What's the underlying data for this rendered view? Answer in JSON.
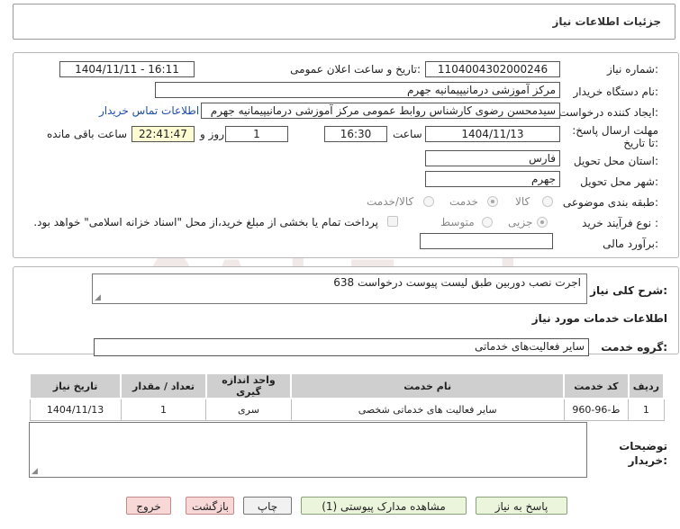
{
  "header": {
    "title": "جزئیات اطلاعات نیاز"
  },
  "labels": {
    "need_number": "شماره نیاز:",
    "announce_datetime": "تاریخ و ساعت اعلان عمومی:",
    "buyer_org": "نام دستگاه خریدار:",
    "requester": "ایجاد کننده درخواست:",
    "deadline": "مهلت ارسال پاسخ: تا تاریخ:",
    "time": "ساعت",
    "days_and": "روز و",
    "remaining": "ساعت باقی مانده",
    "province": "استان محل تحویل:",
    "city": "شهر محل تحویل:",
    "category": "طبقه بندی موضوعی:",
    "purchase_type": "نوع فرآیند خرید :",
    "budget": "برآورد مالی:",
    "need_description": "شرح کلی نیاز:",
    "services_info": "اطلاعات خدمات مورد نیاز",
    "service_group": "گروه خدمت:",
    "buyer_notes": "توضیحات خریدار:"
  },
  "values": {
    "need_number": "1104004302000246",
    "announce_datetime": "1404/11/11 - 16:11",
    "buyer_org": "مرکز آموزشی درمانیپیمانیه جهرم",
    "requester": "سیدمحسن رضوی کارشناس روابط عمومی مرکز آموزشی درمانیپیمانیه جهرم",
    "contact_link": "اطلاعات تماس خریدار",
    "deadline_date": "1404/11/13",
    "deadline_time": "16:30",
    "days": "1",
    "remaining_time": "22:41:47",
    "province": "فارس",
    "city": "جهرم",
    "budget": "",
    "need_description": "اجرت نصب دوربین طبق لیست پیوست درخواست 638",
    "service_group": "سایر فعالیت‌های خدماتی",
    "buyer_notes": ""
  },
  "category_options": [
    {
      "label": "کالا",
      "selected": false
    },
    {
      "label": "خدمت",
      "selected": true
    },
    {
      "label": "کالا/خدمت",
      "selected": false
    }
  ],
  "purchase_options": [
    {
      "label": "جزیی",
      "selected": true
    },
    {
      "label": "متوسط",
      "selected": false
    }
  ],
  "payment_note": "پرداخت تمام یا بخشی از مبلغ خرید،از محل \"اسناد خزانه اسلامی\" خواهد بود.",
  "table": {
    "headers": [
      "ردیف",
      "کد خدمت",
      "نام خدمت",
      "واحد اندازه گیری",
      "تعداد / مقدار",
      "تاریخ نیاز"
    ],
    "rows": [
      [
        "1",
        "ط-96-960",
        "سایر فعالیت های خدماتی شخصی",
        "سری",
        "1",
        "1404/11/13"
      ]
    ]
  },
  "buttons": {
    "reply": "پاسخ به نیاز",
    "view_attachments": "مشاهده مدارک پیوستی (1)",
    "print": "چاپ",
    "back": "بازگشت",
    "exit": "خروج"
  },
  "watermark": "AriaTender.net"
}
